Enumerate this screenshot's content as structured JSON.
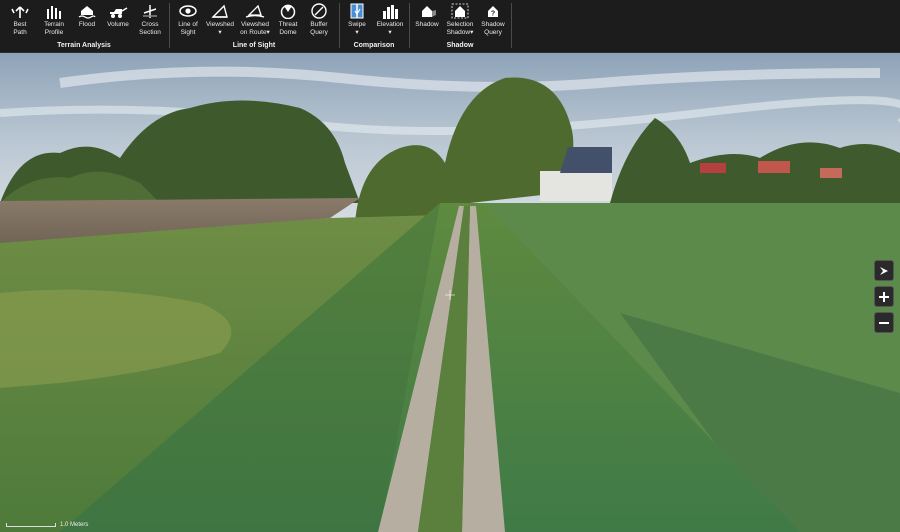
{
  "ribbon": {
    "groups": [
      {
        "id": "terrain",
        "label": "Terrain Analysis",
        "buttons": [
          {
            "label": "Best\nPath",
            "icon": "best-path-icon"
          },
          {
            "label": "Terrain\nProfile",
            "icon": "terrain-profile-icon"
          },
          {
            "label": "Flood",
            "icon": "flood-icon"
          },
          {
            "label": "Volume",
            "icon": "volume-icon"
          },
          {
            "label": "Cross\nSection",
            "icon": "cross-section-icon"
          }
        ]
      },
      {
        "id": "los",
        "label": "Line of Sight",
        "buttons": [
          {
            "label": "Line of\nSight",
            "icon": "line-of-sight-icon"
          },
          {
            "label": "Viewshed\n▾",
            "icon": "viewshed-icon"
          },
          {
            "label": "Viewshed\non Route▾",
            "icon": "viewshed-route-icon"
          },
          {
            "label": "Threat\nDome",
            "icon": "threat-dome-icon"
          },
          {
            "label": "Buffer\nQuery",
            "icon": "buffer-query-icon"
          }
        ]
      },
      {
        "id": "comparison",
        "label": "Comparison",
        "buttons": [
          {
            "label": "Swipe\n▾",
            "icon": "swipe-icon"
          },
          {
            "label": "Elevation\n▾",
            "icon": "elevation-icon"
          }
        ]
      },
      {
        "id": "shadow",
        "label": "Shadow",
        "buttons": [
          {
            "label": "Shadow",
            "icon": "shadow-icon"
          },
          {
            "label": "Selection\nShadow▾",
            "icon": "selection-shadow-icon"
          },
          {
            "label": "Shadow\nQuery",
            "icon": "shadow-query-icon"
          }
        ]
      }
    ]
  },
  "viewport": {
    "scale_label": "1.0 Meters",
    "nav": [
      "compass-arrow-icon",
      "zoom-in-icon",
      "zoom-out-icon"
    ]
  }
}
